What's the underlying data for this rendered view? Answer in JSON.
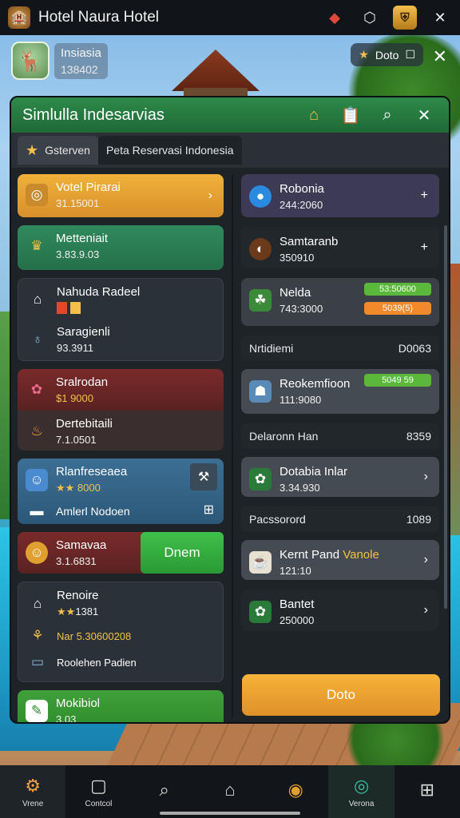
{
  "topbar": {
    "title": "Hotel Naura Hotel",
    "icons": [
      "diamond-icon",
      "shield-icon",
      "badge-icon",
      "close-icon"
    ]
  },
  "profile": {
    "name": "Insiasia",
    "value": "138402"
  },
  "chip": {
    "label": "Doto"
  },
  "panel": {
    "title": "Simlulla Indesarvias",
    "tabs": [
      {
        "label": "Gsterven"
      },
      {
        "label": "Peta Reservasi Indonesia"
      }
    ]
  },
  "left": {
    "item1": {
      "title": "Votel Pirarai",
      "value": "31.15001"
    },
    "item2": {
      "title": "Metteniait",
      "value": "3.83.9.03"
    },
    "item3": {
      "title": "Nahuda Radeel"
    },
    "item4": {
      "title": "Saragienli",
      "value": "93.3911"
    },
    "item5": {
      "title": "Sralrodan",
      "value": "$1 9000"
    },
    "item6": {
      "title": "Dertebitaili",
      "value": "7.1.0501"
    },
    "item7": {
      "title": "Rlanfreseaea",
      "value": "8000"
    },
    "item8": {
      "title": "Amlerl Nodoen"
    },
    "item9": {
      "title": "Samavaa",
      "value": "3.1.6831",
      "button": "Dnem"
    },
    "item10": {
      "title": "Renoire",
      "value": "1381"
    },
    "item11": {
      "title": "Nar",
      "value": "5.30600208"
    },
    "item12": {
      "title": "Roolehen Padien"
    },
    "item13": {
      "title": "Mokibiol",
      "value": "3.03"
    }
  },
  "right": {
    "r1": {
      "title": "Robonia",
      "value": "244:2060"
    },
    "r2": {
      "title": "Samtaranb",
      "value": "350910"
    },
    "r3": {
      "title": "Nelda",
      "value": "743:3000",
      "tag1": "53:50600",
      "tag2": "5039(5)"
    },
    "h1": {
      "left": "Nrtidiemi",
      "right": "D0063"
    },
    "r4": {
      "title": "Reokemfioon",
      "value": "111:9080",
      "tag": "5049 59"
    },
    "h2": {
      "left": "Delaronn Han",
      "right": "8359"
    },
    "r5": {
      "title": "Dotabia Inlar",
      "value": "3.34.930"
    },
    "h3": {
      "left": "Pacssorord",
      "right": "1089"
    },
    "r6": {
      "title": "Kernt Pand",
      "title2": "Vanole",
      "value": "121:10"
    },
    "r7": {
      "title": "Bantet",
      "value": "250000"
    },
    "done": "Doto"
  },
  "nav": [
    {
      "label": "Vrene",
      "icon": "dashboard-icon"
    },
    {
      "label": "Contcol",
      "icon": "box-icon"
    },
    {
      "label": "",
      "icon": "search-icon"
    },
    {
      "label": "",
      "icon": "map-icon"
    },
    {
      "label": "",
      "icon": "profile-icon"
    },
    {
      "label": "Verona",
      "icon": "globe-icon"
    },
    {
      "label": "",
      "icon": "grid-icon"
    }
  ]
}
